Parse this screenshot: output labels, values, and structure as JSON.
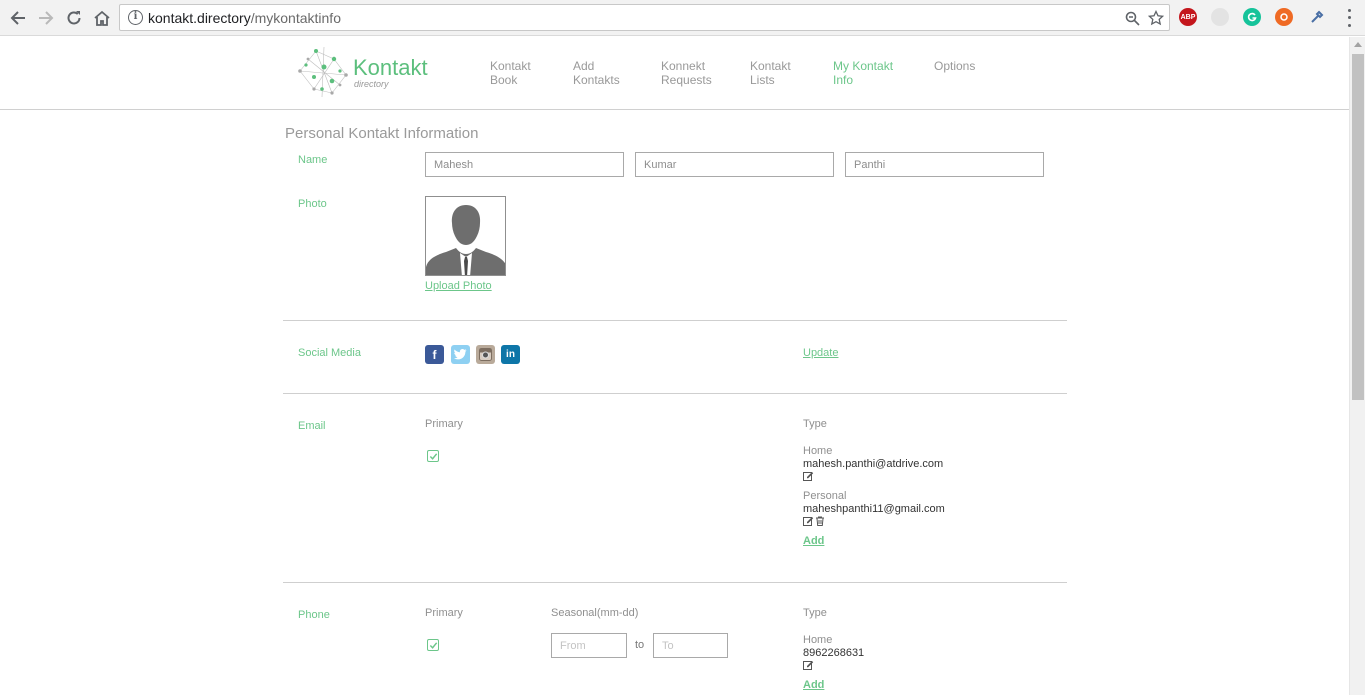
{
  "browser": {
    "url_domain": "kontakt.directory",
    "url_path": "/mykontaktinfo",
    "ext_abp": "ABP"
  },
  "site": {
    "logo_text": "Kontakt",
    "logo_sub": "directory",
    "nav": [
      {
        "line1": "Kontakt",
        "line2": "Book"
      },
      {
        "line1": "Add",
        "line2": "Kontakts"
      },
      {
        "line1": "Konnekt",
        "line2": "Requests"
      },
      {
        "line1": "Kontakt",
        "line2": "Lists"
      },
      {
        "line1": "My Kontakt",
        "line2": "Info"
      },
      {
        "line1": "Options",
        "line2": ""
      }
    ]
  },
  "page": {
    "title": "Personal Kontakt Information",
    "name_label": "Name",
    "first_name": "Mahesh",
    "middle_name": "Kumar",
    "last_name": "Panthi",
    "photo_label": "Photo",
    "upload_photo": "Upload Photo",
    "social_label": "Social Media",
    "social_update": "Update",
    "email": {
      "label": "Email",
      "primary_header": "Primary",
      "type_header": "Type",
      "entries": [
        {
          "type": "Home",
          "value": "mahesh.panthi@atdrive.com"
        },
        {
          "type": "Personal",
          "value": "maheshpanthi11@gmail.com"
        }
      ],
      "add": "Add"
    },
    "phone": {
      "label": "Phone",
      "primary_header": "Primary",
      "seasonal_header": "Seasonal(mm-dd)",
      "type_header": "Type",
      "from_placeholder": "From",
      "to_text": "to",
      "to_placeholder": "To",
      "entries": [
        {
          "type": "Home",
          "value": "8962268631"
        }
      ],
      "add": "Add"
    }
  },
  "colors": {
    "accent": "#6cc68a",
    "muted_text": "#999999",
    "facebook": "#3b5998",
    "twitter": "#55acee",
    "instagram": "#8a8a8a",
    "linkedin": "#0e76a8"
  }
}
